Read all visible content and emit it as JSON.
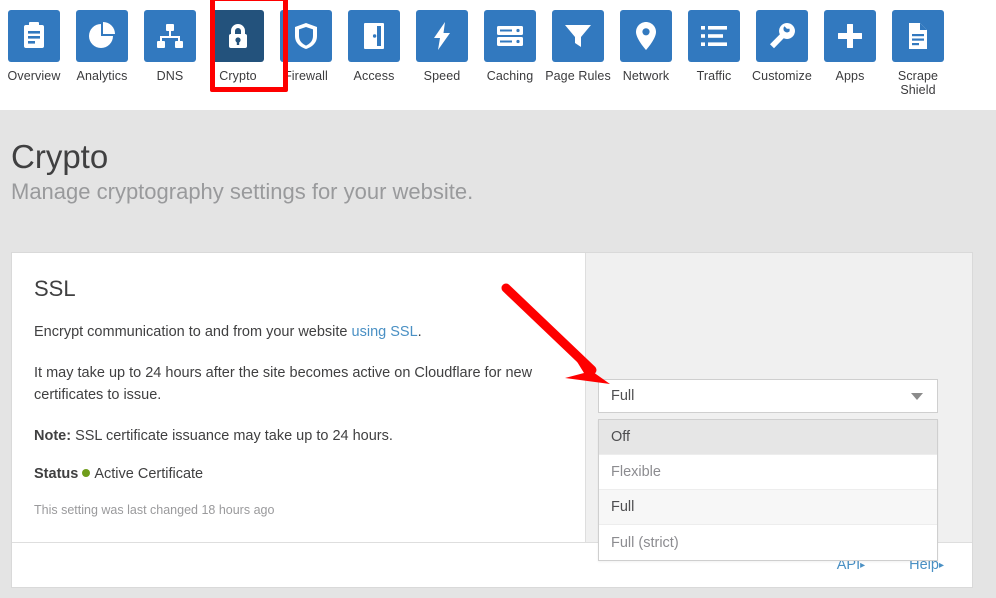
{
  "nav": {
    "items": [
      {
        "label": "Overview",
        "icon": "clipboard-icon",
        "active": false
      },
      {
        "label": "Analytics",
        "icon": "pie-chart-icon",
        "active": false
      },
      {
        "label": "DNS",
        "icon": "sitemap-icon",
        "active": false
      },
      {
        "label": "Crypto",
        "icon": "lock-icon",
        "active": true
      },
      {
        "label": "Firewall",
        "icon": "shield-icon",
        "active": false
      },
      {
        "label": "Access",
        "icon": "door-icon",
        "active": false
      },
      {
        "label": "Speed",
        "icon": "bolt-icon",
        "active": false
      },
      {
        "label": "Caching",
        "icon": "server-icon",
        "active": false
      },
      {
        "label": "Page Rules",
        "icon": "funnel-icon",
        "active": false
      },
      {
        "label": "Network",
        "icon": "map-pin-icon",
        "active": false
      },
      {
        "label": "Traffic",
        "icon": "list-icon",
        "active": false
      },
      {
        "label": "Customize",
        "icon": "wrench-icon",
        "active": false
      },
      {
        "label": "Apps",
        "icon": "plus-icon",
        "active": false
      },
      {
        "label": "Scrape Shield",
        "icon": "document-icon",
        "active": false
      }
    ],
    "highlight_target": "Crypto",
    "highlight_color": "#fe0000",
    "tile_color": "#3279bf",
    "tile_active_color": "#23527c"
  },
  "page": {
    "title": "Crypto",
    "subtitle": "Manage cryptography settings for your website."
  },
  "ssl_card": {
    "heading": "SSL",
    "desc_prefix": "Encrypt communication to and from your website ",
    "desc_link": "using SSL",
    "desc_suffix": ".",
    "timing_text": "It may take up to 24 hours after the site becomes active on Cloudflare for new certificates to issue.",
    "note_label": "Note:",
    "note_text": " SSL certificate issuance may take up to 24 hours.",
    "status_label": "Status",
    "status_value": "Active Certificate",
    "status_color": "#6f9d1b",
    "last_changed": "This setting was last changed 18 hours ago",
    "select": {
      "value": "Full",
      "expanded": true,
      "caret_icon": "chevron-down-icon",
      "options": [
        {
          "label": "Off",
          "state": "hover"
        },
        {
          "label": "Flexible",
          "state": "normal"
        },
        {
          "label": "Full",
          "state": "selected"
        },
        {
          "label": "Full (strict)",
          "state": "normal"
        }
      ]
    },
    "footer": {
      "api_label": "API",
      "help_label": "Help",
      "link_arrow": "▸"
    }
  },
  "annotation": {
    "arrow_color": "#fe0000",
    "arrow_from": "505,288",
    "arrow_to": "607,383"
  }
}
